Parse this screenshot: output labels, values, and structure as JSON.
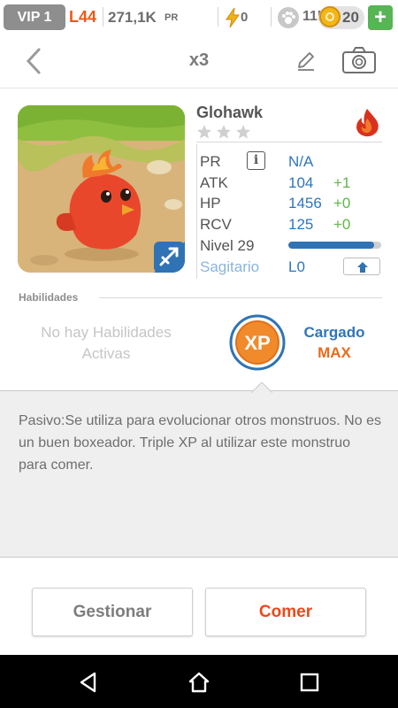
{
  "status_bar": {
    "vip": "VIP 1",
    "level": "L44",
    "power": "271,1K",
    "power_unit": "PR",
    "energy": "0",
    "food": "11K",
    "gems": "20",
    "add_icon": "plus-icon"
  },
  "header": {
    "back_icon": "chevron-left-icon",
    "count": "x3",
    "edit_icon": "pencil-icon",
    "camera_icon": "camera-icon"
  },
  "monster": {
    "name": "Glohawk",
    "stars_total": 3,
    "stars_filled": 0,
    "element_icon": "fire-icon",
    "class_icon": "archer-icon",
    "stats": [
      {
        "label": "PR",
        "value": "N/A",
        "bonus": ""
      },
      {
        "label": "ATK",
        "value": "104",
        "bonus": "+1"
      },
      {
        "label": "HP",
        "value": "1456",
        "bonus": "+0"
      },
      {
        "label": "RCV",
        "value": "125",
        "bonus": "+0"
      }
    ],
    "level_label": "Nivel 29",
    "level_progress": 0.92,
    "sign": "Sagitario",
    "sign_level": "L0",
    "upgrade_icon": "arrow-up-icon"
  },
  "skills": {
    "title": "Habilidades",
    "empty_line1": "No hay Habilidades",
    "empty_line2": "Activas",
    "xp_label": "XP",
    "charged_label": "Cargado",
    "charged_value": "MAX"
  },
  "description": {
    "text": "Pasivo:Se utiliza para evolucionar otros monstruos. No es un buen boxeador. Triple XP al utilizar este monstruo para comer."
  },
  "actions": {
    "manage": "Gestionar",
    "eat": "Comer"
  },
  "nav": {
    "back_icon": "triangle-back-icon",
    "home_icon": "home-icon",
    "recents_icon": "square-recents-icon"
  },
  "colors": {
    "accent_blue": "#2f76ba",
    "accent_orange": "#ec6a1a",
    "bonus_green": "#5fb746",
    "eat_red": "#ea4a1a"
  }
}
